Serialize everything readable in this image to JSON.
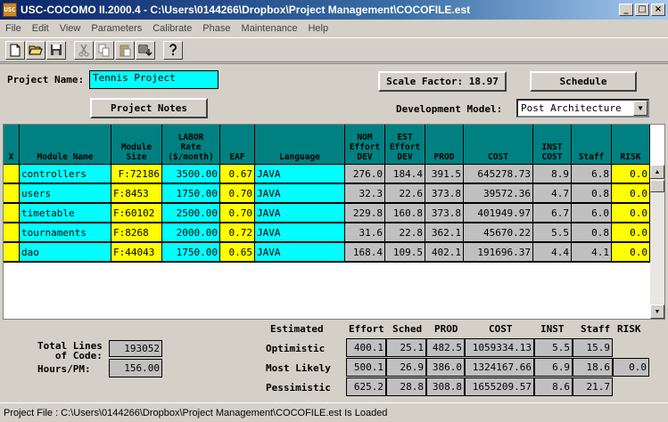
{
  "window": {
    "app_icon_text": "USC",
    "title": "USC-COCOMO II.2000.4 - C:\\Users\\0144266\\Dropbox\\Project Management\\COCOFILE.est",
    "minimize": "_",
    "maximize": "□",
    "close": "×"
  },
  "menu": [
    "File",
    "Edit",
    "View",
    "Parameters",
    "Calibrate",
    "Phase",
    "Maintenance",
    "Help"
  ],
  "project": {
    "name_label": "Project Name:",
    "name_value": "Tennis Project",
    "scale_factor": "Scale Factor: 18.97",
    "schedule_button": "Schedule",
    "notes_button": "Project Notes",
    "dev_model_label": "Development Model:",
    "dev_model_value": "Post Architecture"
  },
  "table": {
    "headers": [
      "X",
      "Module Name",
      "Module\nSize",
      "LABOR\nRate\n($/month)",
      "EAF",
      "Language",
      "NOM\nEffort\nDEV",
      "EST\nEffort\nDEV",
      "PROD",
      "COST",
      "INST\nCOST",
      "Staff",
      "RISK"
    ],
    "rows": [
      {
        "x": "",
        "name": "controllers",
        "size": "F:72186",
        "rate": "3500.00",
        "eaf": "0.67",
        "lang": "JAVA",
        "nom": "276.0",
        "est": "184.4",
        "prod": "391.5",
        "cost": "645278.73",
        "inst": "8.9",
        "staff": "6.8",
        "risk": "0.0"
      },
      {
        "x": "",
        "name": "users",
        "size": "F:8453",
        "rate": "1750.00",
        "eaf": "0.70",
        "lang": "JAVA",
        "nom": "32.3",
        "est": "22.6",
        "prod": "373.8",
        "cost": "39572.36",
        "inst": "4.7",
        "staff": "0.8",
        "risk": "0.0"
      },
      {
        "x": "",
        "name": "timetable",
        "size": "F:60102",
        "rate": "2500.00",
        "eaf": "0.70",
        "lang": "JAVA",
        "nom": "229.8",
        "est": "160.8",
        "prod": "373.8",
        "cost": "401949.97",
        "inst": "6.7",
        "staff": "6.0",
        "risk": "0.0"
      },
      {
        "x": "",
        "name": "tournaments",
        "size": "F:8268",
        "rate": "2000.00",
        "eaf": "0.72",
        "lang": "JAVA",
        "nom": "31.6",
        "est": "22.8",
        "prod": "362.1",
        "cost": "45670.22",
        "inst": "5.5",
        "staff": "0.8",
        "risk": "0.0"
      },
      {
        "x": "",
        "name": "dao",
        "size": "F:44043",
        "rate": "1750.00",
        "eaf": "0.65",
        "lang": "JAVA",
        "nom": "168.4",
        "est": "109.5",
        "prod": "402.1",
        "cost": "191696.37",
        "inst": "4.4",
        "staff": "4.1",
        "risk": "0.0"
      }
    ]
  },
  "summary": {
    "total_lines_label": "Total Lines\nof Code:",
    "total_lines_value": "193052",
    "hours_label": "Hours/PM:",
    "hours_value": "156.00",
    "headers": [
      "Estimated",
      "Effort",
      "Sched",
      "PROD",
      "COST",
      "INST",
      "Staff",
      "RISK"
    ],
    "rows": [
      {
        "label": "Optimistic",
        "effort": "400.1",
        "sched": "25.1",
        "prod": "482.5",
        "cost": "1059334.13",
        "inst": "5.5",
        "staff": "15.9",
        "risk": ""
      },
      {
        "label": "Most Likely",
        "effort": "500.1",
        "sched": "26.9",
        "prod": "386.0",
        "cost": "1324167.66",
        "inst": "6.9",
        "staff": "18.6",
        "risk": "0.0"
      },
      {
        "label": "Pessimistic",
        "effort": "625.2",
        "sched": "28.8",
        "prod": "308.8",
        "cost": "1655209.57",
        "inst": "8.6",
        "staff": "21.7",
        "risk": ""
      }
    ]
  },
  "status": "Project File : C:\\Users\\0144266\\Dropbox\\Project Management\\COCOFILE.est Is Loaded"
}
